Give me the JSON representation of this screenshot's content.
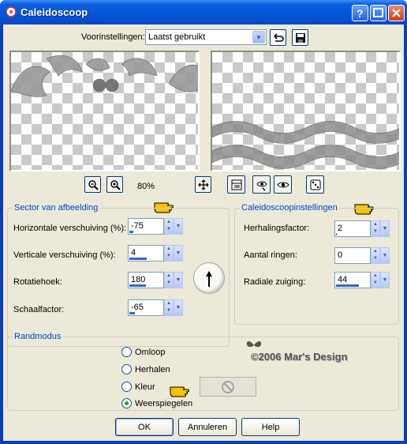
{
  "window": {
    "title": "Caleidoscoop"
  },
  "presets": {
    "label": "Voorinstellingen:",
    "value": "Laatst gebruikt"
  },
  "preview": {
    "zoom": "80%"
  },
  "sector": {
    "title": "Sector van afbeelding",
    "rows": [
      {
        "label": "Horizontale verschuiving (%):",
        "value": "-75",
        "fill": 0.125
      },
      {
        "label": "Verticale verschuiving (%):",
        "value": "4",
        "fill": 0.52
      },
      {
        "label": "Rotatiehoek:",
        "value": "180",
        "fill": 0.5
      },
      {
        "label": "Schaalfactor:",
        "value": "-65",
        "fill": 0.17
      }
    ]
  },
  "kaleido": {
    "title": "Caleidoscoopinstellingen",
    "rows": [
      {
        "label": "Herhalingsfactor:",
        "value": "2",
        "fill": 0.03
      },
      {
        "label": "Aantal ringen:",
        "value": "0",
        "fill": 0.0
      },
      {
        "label": "Radiale zuiging:",
        "value": "44",
        "fill": 0.7
      }
    ]
  },
  "edge": {
    "title": "Randmodus",
    "options": [
      "Omloop",
      "Herhalen",
      "Kleur",
      "Weerspiegelen"
    ],
    "selected": "Weerspiegelen"
  },
  "credit": "©2006 Mar's Design",
  "buttons": {
    "ok": "OK",
    "cancel": "Annuleren",
    "help": "Help"
  },
  "colors": {
    "title_blue": "#0554d8",
    "group_title": "#0046d5",
    "face": "#ece9d8",
    "hand": "#f5c400"
  }
}
